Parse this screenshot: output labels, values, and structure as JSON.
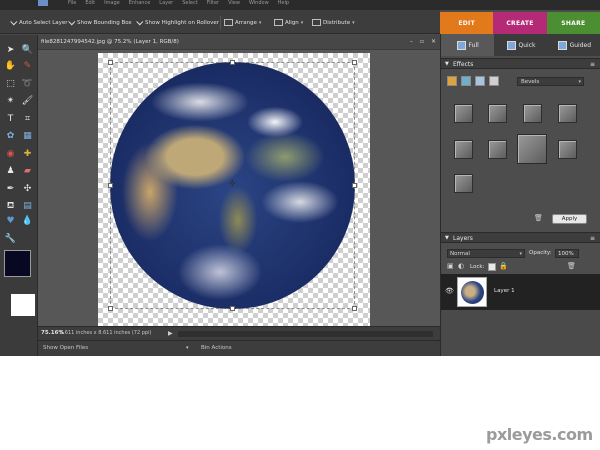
{
  "menubar": {
    "items": [
      "File",
      "Edit",
      "Image",
      "Enhance",
      "Layer",
      "Select",
      "Filter",
      "View",
      "Window",
      "Help"
    ]
  },
  "options": {
    "auto_select": "Auto Select Layer",
    "bounding_box": "Show Bounding Box",
    "highlight": "Show Highlight on Rollover",
    "arrange": "Arrange",
    "align": "Align",
    "distribute": "Distribute"
  },
  "mode_tabs": {
    "edit": "EDIT",
    "create": "CREATE",
    "share": "SHARE"
  },
  "document": {
    "title": "file8281247994542.jpg @ 75.2% (Layer 1, RGB/8)",
    "zoom": "75.16%",
    "info": "8.611 inches x 8.611 inches (72 ppi)"
  },
  "colors": {
    "foreground": "#080822",
    "background": "#ffffff",
    "edit_tab": "#e27a1b",
    "create_tab": "#b42a77",
    "share_tab": "#4c8f32"
  },
  "project_bin": {
    "show": "Show Open Files",
    "actions": "Bin Actions"
  },
  "panel": {
    "view_tabs": {
      "full": "Full",
      "quick": "Quick",
      "guided": "Guided"
    },
    "effects": {
      "title": "Effects",
      "style": "Bevels",
      "apply": "Apply"
    },
    "layers": {
      "title": "Layers",
      "blend_mode": "Normal",
      "opacity_label": "Opacity:",
      "opacity_value": "100%",
      "lock_label": "Lock:",
      "layer_name": "Layer 1"
    }
  },
  "watermark": "pxleyes.com"
}
